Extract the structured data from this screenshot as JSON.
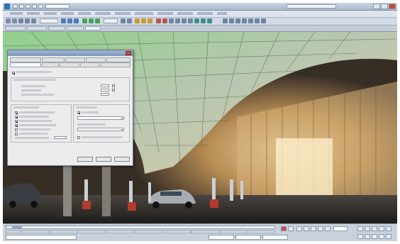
{
  "colors": {
    "sky": "#1c1f24",
    "canopy_green": "#7fc27a",
    "building_light": "#f2c98a",
    "window_chrome": "#c9d5e6",
    "dialog_bg": "#ececec"
  },
  "icons": {
    "app": "3ds-max-app-icon",
    "close": "close-icon",
    "search": "search-icon",
    "play": "play-icon",
    "key": "key-icon"
  },
  "dialog": {
    "name": "render-setup-dialog",
    "tabs_row1_count": 5,
    "tabs_row2_count": 5,
    "sections": [
      "global-switches",
      "sampling",
      "reflections-refractions",
      "advanced",
      "contours"
    ]
  },
  "scene": {
    "cars_visible": 2,
    "bollards_visible": 6
  }
}
